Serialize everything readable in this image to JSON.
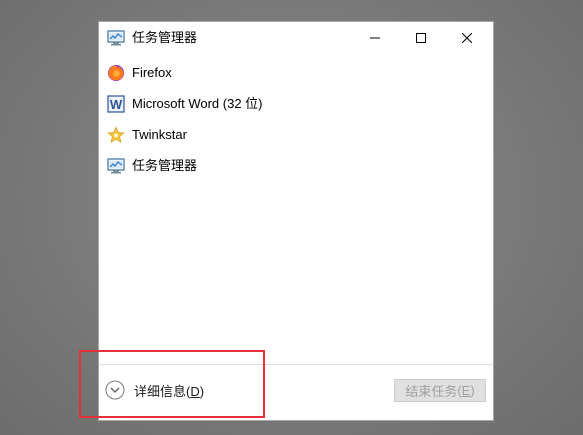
{
  "window": {
    "title": "任务管理器",
    "controls": {
      "minimize": "minimize",
      "maximize": "maximize",
      "close": "close"
    }
  },
  "tasks": [
    {
      "label": "Firefox",
      "icon": "firefox-icon"
    },
    {
      "label": "Microsoft Word (32 位)",
      "icon": "word-icon"
    },
    {
      "label": "Twinkstar",
      "icon": "twinkstar-icon"
    },
    {
      "label": "任务管理器",
      "icon": "task-manager-icon"
    }
  ],
  "footer": {
    "details_label": "详细信息",
    "details_key": "D",
    "end_task_label": "结束任务",
    "end_task_key": "E"
  },
  "colors": {
    "highlight": "#e53035",
    "word_blue": "#2b579a",
    "firefox_orange": "#ff7a1a",
    "firefox_purple": "#7a2fd1",
    "star_yellow": "#f5c542",
    "disabled_button_bg": "#e0e0e0",
    "disabled_text": "#a0a0a0"
  }
}
